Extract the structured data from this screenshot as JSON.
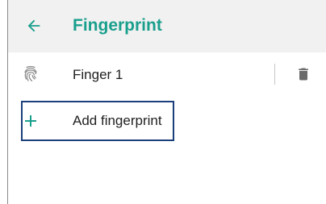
{
  "header": {
    "title": "Fingerprint",
    "back_icon": "arrow-left-icon",
    "accent_color": "#1a9f8d"
  },
  "fingerprints": [
    {
      "label": "Finger 1",
      "icon": "fingerprint-icon",
      "action_icon": "trash-icon"
    }
  ],
  "add": {
    "label": "Add fingerprint",
    "icon": "plus-icon",
    "focus_color": "#1b3f7a"
  }
}
